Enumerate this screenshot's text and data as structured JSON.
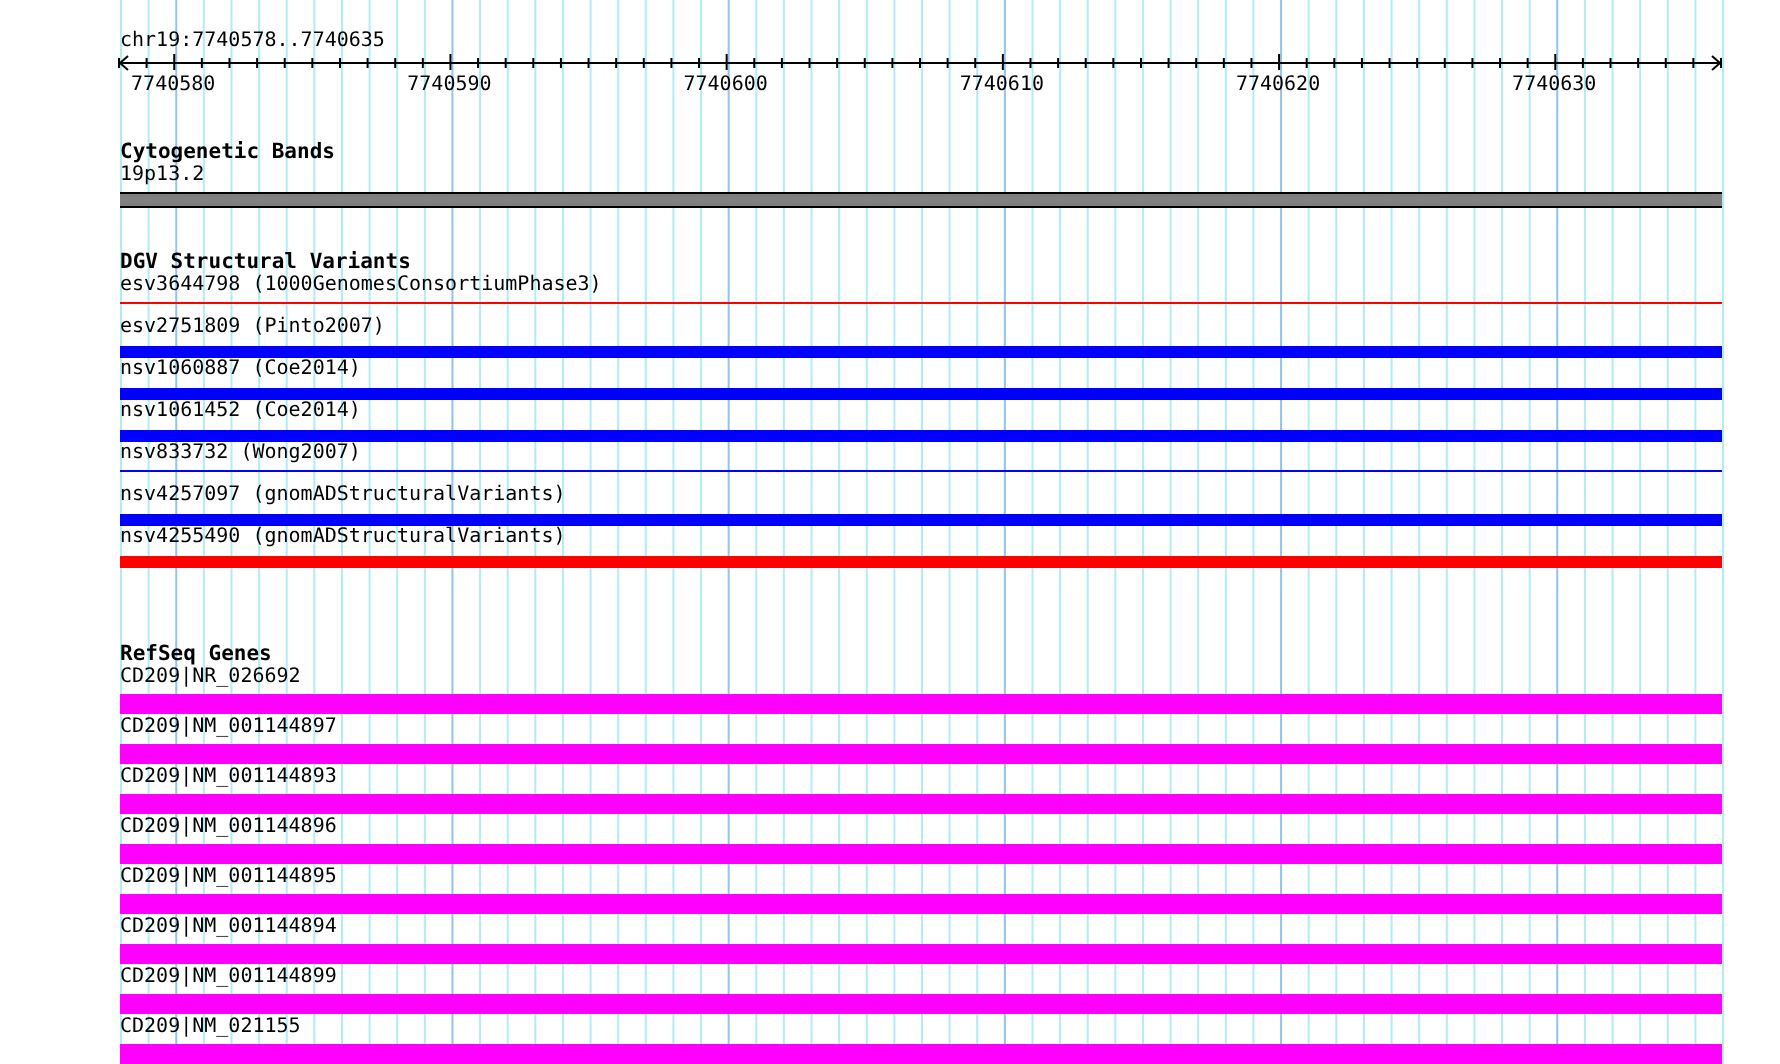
{
  "ruler": {
    "range": "chr19:7740578..7740635",
    "ticks": [
      "7740580",
      "7740590",
      "7740600",
      "7740610",
      "7740620",
      "7740630"
    ]
  },
  "tracks": [
    {
      "title": "Cytogenetic Bands",
      "features": [
        {
          "label": "19p13.2",
          "kind": "band",
          "color": "#808080"
        }
      ]
    },
    {
      "title": "DGV Structural Variants",
      "features": [
        {
          "label": "esv3644798 (1000GenomesConsortiumPhase3)",
          "kind": "line",
          "color": "#ff0000"
        },
        {
          "label": "esv2751809 (Pinto2007)",
          "kind": "bar",
          "color": "#0000ff"
        },
        {
          "label": "nsv1060887 (Coe2014)",
          "kind": "bar",
          "color": "#0000ff"
        },
        {
          "label": "nsv1061452 (Coe2014)",
          "kind": "bar",
          "color": "#0000ff"
        },
        {
          "label": "nsv833732 (Wong2007)",
          "kind": "line",
          "color": "#0000ff"
        },
        {
          "label": "nsv4257097 (gnomADStructuralVariants)",
          "kind": "bar",
          "color": "#0000ff"
        },
        {
          "label": "nsv4255490 (gnomADStructuralVariants)",
          "kind": "bar",
          "color": "#ff0000"
        }
      ]
    },
    {
      "title": "RefSeq Genes",
      "features": [
        {
          "label": "CD209|NR_026692",
          "kind": "gene",
          "color": "#ff00ff"
        },
        {
          "label": "CD209|NM_001144897",
          "kind": "gene",
          "color": "#ff00ff"
        },
        {
          "label": "CD209|NM_001144893",
          "kind": "gene",
          "color": "#ff00ff"
        },
        {
          "label": "CD209|NM_001144896",
          "kind": "gene",
          "color": "#ff00ff"
        },
        {
          "label": "CD209|NM_001144895",
          "kind": "gene",
          "color": "#ff00ff"
        },
        {
          "label": "CD209|NM_001144894",
          "kind": "gene",
          "color": "#ff00ff"
        },
        {
          "label": "CD209|NM_001144899",
          "kind": "gene",
          "color": "#ff00ff"
        },
        {
          "label": "CD209|NM_021155",
          "kind": "gene",
          "color": "#ff00ff"
        }
      ]
    }
  ]
}
